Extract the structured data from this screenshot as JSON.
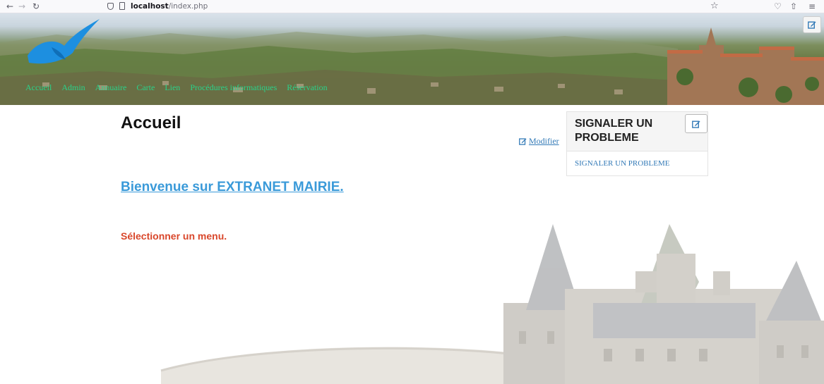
{
  "browser": {
    "url_host": "localhost",
    "url_path": "/index.php",
    "back_glyph": "←",
    "forward_glyph": "→",
    "reload_glyph": "↻",
    "star_glyph": "☆",
    "pocket_glyph": "♡",
    "share_glyph": "⇧",
    "menu_glyph": "≡"
  },
  "header": {
    "nav": [
      {
        "label": "Accueil"
      },
      {
        "label": "Admin"
      },
      {
        "label": "Annuaire"
      },
      {
        "label": "Carte"
      },
      {
        "label": "Lien"
      },
      {
        "label": "Procédures informatiques"
      },
      {
        "label": "Réservation"
      }
    ],
    "edit_icon": "edit-icon"
  },
  "main": {
    "title": "Accueil",
    "modify_label": "Modifier",
    "welcome": "Bienvenue sur EXTRANET MAIRIE.",
    "instruction": "Sélectionner un menu."
  },
  "panel": {
    "title": "SIGNALER UN PROBLEME",
    "link": "SIGNALER UN PROBLEME"
  },
  "colors": {
    "nav_link": "#2ad28a",
    "welcome_link": "#3a9ad9",
    "instruction": "#d9472b",
    "body_link": "#337ab7",
    "logo": "#1d8fe0"
  }
}
